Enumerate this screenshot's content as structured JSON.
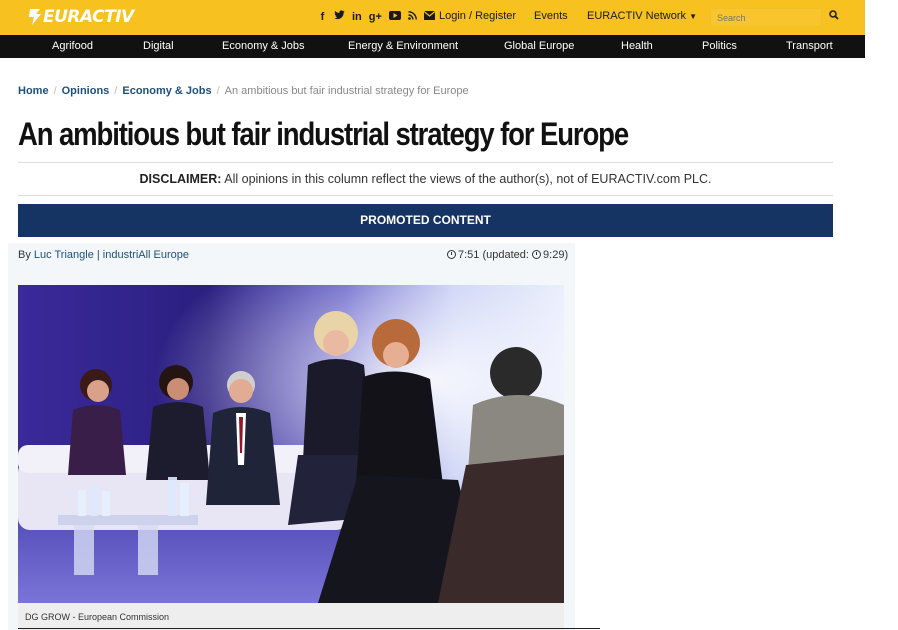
{
  "header": {
    "logo_text": "EURACTIV",
    "social_icons": [
      "facebook-icon",
      "twitter-icon",
      "linkedin-icon",
      "google-plus-icon",
      "youtube-icon",
      "rss-icon",
      "email-icon"
    ],
    "login_label": "Login / Register",
    "events_label": "Events",
    "network_label": "EURACTIV Network",
    "search_placeholder": "Search",
    "brand_color": "#f7c120"
  },
  "nav": {
    "items": [
      "Agrifood",
      "Digital",
      "Economy & Jobs",
      "Energy & Environment",
      "Global Europe",
      "Health",
      "Politics",
      "Transport"
    ]
  },
  "breadcrumb": {
    "items": [
      "Home",
      "Opinions",
      "Economy & Jobs"
    ],
    "current": "An ambitious but fair industrial strategy for Europe"
  },
  "article": {
    "title": "An ambitious but fair industrial strategy for Europe",
    "disclaimer_label": "DISCLAIMER:",
    "disclaimer_text": "All opinions in this column reflect the views of the author(s), not of EURACTIV.com PLC.",
    "promo_label": "PROMOTED CONTENT",
    "byline_prefix": "By",
    "author": "Luc Triangle | industriAll Europe",
    "time": "7:51",
    "updated_prefix": "(updated:",
    "updated_time": "9:29)",
    "photo_caption": "DG GROW - European Commission",
    "promo_color": "#163463"
  }
}
